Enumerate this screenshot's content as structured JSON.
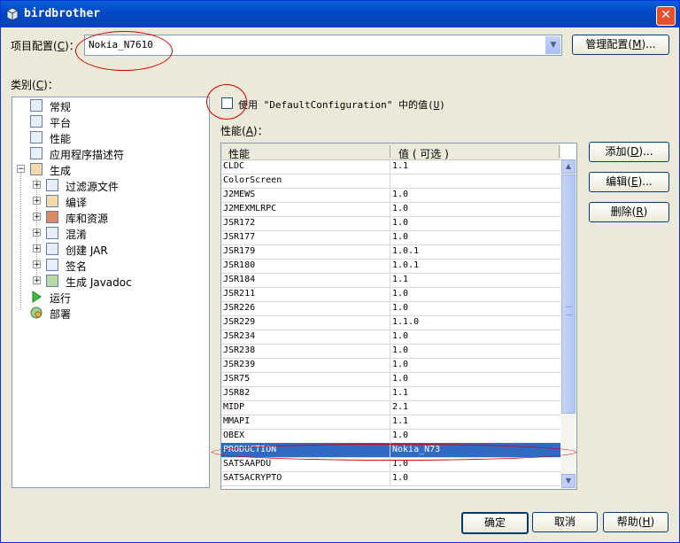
{
  "window": {
    "title": "birdbrother",
    "close_glyph": "✕"
  },
  "config": {
    "label": "项目配置",
    "label_key": "C",
    "selected": "Nokia_N7610",
    "manage_button": "管理配置",
    "manage_key": "M"
  },
  "category": {
    "label": "类别",
    "label_key": "C",
    "items": [
      {
        "label": "常规",
        "icon": "general-icon"
      },
      {
        "label": "平台",
        "icon": "platform-icon"
      },
      {
        "label": "性能",
        "icon": "abilities-icon"
      },
      {
        "label": "应用程序描述符",
        "icon": "descriptor-icon"
      },
      {
        "label": "生成",
        "icon": "build-icon"
      },
      {
        "label": "过滤源文件",
        "icon": "filter-icon"
      },
      {
        "label": "编译",
        "icon": "compile-icon"
      },
      {
        "label": "库和资源",
        "icon": "library-icon"
      },
      {
        "label": "混淆",
        "icon": "obfuscate-icon"
      },
      {
        "label": "创建 JAR",
        "icon": "jar-icon"
      },
      {
        "label": "签名",
        "icon": "sign-icon"
      },
      {
        "label": "生成 Javadoc",
        "icon": "javadoc-icon"
      },
      {
        "label": "运行",
        "icon": "run-icon"
      },
      {
        "label": "部署",
        "icon": "deploy-icon"
      }
    ]
  },
  "use_default": {
    "label": "使用 \"DefaultConfiguration\" 中的值",
    "key": "U",
    "checked": false
  },
  "abilities": {
    "label": "性能",
    "label_key": "A",
    "columns": [
      "性能",
      "值 ( 可选 )"
    ],
    "rows": [
      [
        "CLDC",
        "1.1"
      ],
      [
        "ColorScreen",
        ""
      ],
      [
        "J2MEWS",
        "1.0"
      ],
      [
        "J2MEXMLRPC",
        "1.0"
      ],
      [
        "JSR172",
        "1.0"
      ],
      [
        "JSR177",
        "1.0"
      ],
      [
        "JSR179",
        "1.0.1"
      ],
      [
        "JSR180",
        "1.0.1"
      ],
      [
        "JSR184",
        "1.1"
      ],
      [
        "JSR211",
        "1.0"
      ],
      [
        "JSR226",
        "1.0"
      ],
      [
        "JSR229",
        "1.1.0"
      ],
      [
        "JSR234",
        "1.0"
      ],
      [
        "JSR238",
        "1.0"
      ],
      [
        "JSR239",
        "1.0"
      ],
      [
        "JSR75",
        "1.0"
      ],
      [
        "JSR82",
        "1.1"
      ],
      [
        "MIDP",
        "2.1"
      ],
      [
        "MMAPI",
        "1.1"
      ],
      [
        "OBEX",
        "1.0"
      ],
      [
        "PRODUCTION",
        "Nokia_N73"
      ],
      [
        "SATSAAPDU",
        "1.0"
      ],
      [
        "SATSACRYPTO",
        "1.0"
      ]
    ],
    "selected_row": 20
  },
  "side_buttons": {
    "add": "添加",
    "add_key": "D",
    "edit": "编辑",
    "edit_key": "E",
    "remove": "删除",
    "remove_key": "R"
  },
  "footer": {
    "ok": "确定",
    "cancel": "取消",
    "help": "帮助",
    "help_key": "H"
  },
  "colors": {
    "selection": "#316ac5",
    "annotation": "#d40000",
    "titlebar": "#0a5fd8"
  }
}
